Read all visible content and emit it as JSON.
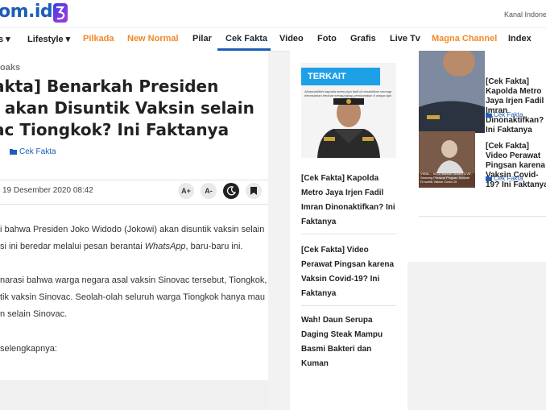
{
  "header": {
    "logo_text": "om.id",
    "kanal_text": "Kanal Indone"
  },
  "nav": {
    "items": [
      {
        "label": "s ▾"
      },
      {
        "label": "Lifestyle ▾"
      },
      {
        "label": "Pilkada"
      },
      {
        "label": "New Normal"
      },
      {
        "label": "Pilar"
      },
      {
        "label": "Cek Fakta"
      },
      {
        "label": "Video"
      },
      {
        "label": "Foto"
      },
      {
        "label": "Grafis"
      },
      {
        "label": "Live Tv"
      },
      {
        "label": "Magna Channel"
      },
      {
        "label": "Index"
      }
    ],
    "highlight_color": "#f08a24",
    "accent_color": "#1c5eb6"
  },
  "article": {
    "breadcrumb": "oaks",
    "title": "akta] Benarkah Presiden\ni akan Disuntik Vaksin selain\nac Tiongkok? Ini Faktanya",
    "category": "Cek Fakta",
    "date": "19 Desember 2020 08:42",
    "tools": {
      "increase": "A+",
      "decrease": "A-"
    },
    "paragraphs": {
      "p1_line1": "i bahwa Presiden Joko Widodo (Jokowi) akan disuntik vaksin selain",
      "p1_line2_pre": "si ini beredar melalui pesan berantai ",
      "p1_line2_em": "WhatsApp",
      "p1_line2_post": ", baru-baru ini.",
      "p2_line1": "narasi bahwa warga negara asal vaksin Sinovac tersebut, Tiongkok,",
      "p2_line2": "tik vaksin Sinovac. Seolah-olah seluruh warga Tiongkok hanya mau",
      "p2_line3": "n selain Sinovac.",
      "p3_line1": "selengkapnya:"
    }
  },
  "sidebar": {
    "badge": "TERKAIT",
    "image_caption": "Alhamdulillah kapolda metro jaya fadil di nonaktifkan semoga kemaslahan berkuat mengungkap pembantaian 6 warga sipil",
    "links": [
      {
        "title": "[Cek Fakta] Kapolda Metro Jaya Irjen Fadil Imran Dinonaktifkan? Ini Faktanya"
      },
      {
        "title": "[Cek Fakta] Video Perawat Pingsan karena Vaksin Covid-19? Ini Faktanya"
      },
      {
        "title": "Wah! Daun Serupa Daging Steak Mampu Basmi Bakteri dan Kuman"
      }
    ]
  },
  "right_column": {
    "items": [
      {
        "title": "[Cek Fakta] Kapolda Metro Jaya Irjen Fadil Imran Dinonaktifkan? Ini Faktanya",
        "category": "Cek Fakta"
      },
      {
        "title": "[Cek Fakta] Video Perawat Pingsan karena Vaksin Covid-19? Ini Faktanya",
        "category": "Cek Fakta"
      }
    ],
    "thumb_text": "VIRAL... Ini Di slarkan Secara LIVE. Seorang Perawat Pingsan Setelah Di suntik Vaksin Covid-19"
  }
}
